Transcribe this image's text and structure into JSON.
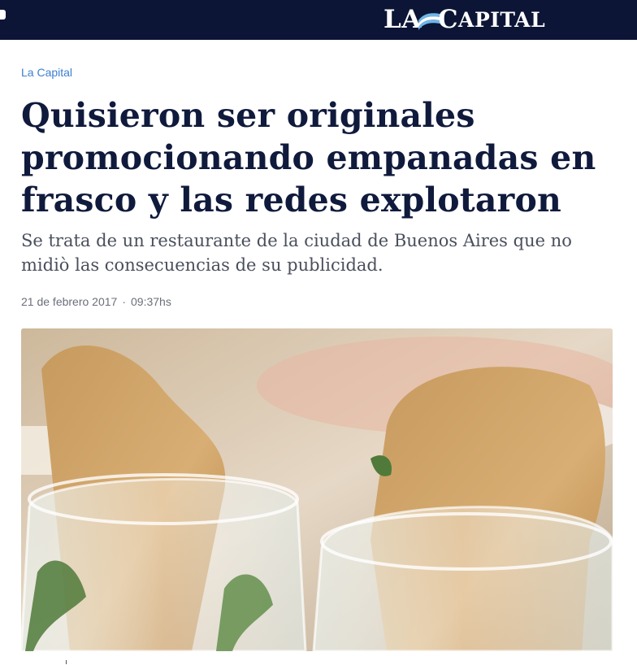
{
  "header": {
    "logo_la": "LA",
    "logo_capital": "CAPITAL",
    "brand_color": "#0c1535"
  },
  "article": {
    "section": "La Capital",
    "title": "Quisieron ser originales promocionando empanadas en frasco y las redes explotaron",
    "subtitle": "Se trata de un restaurante de la ciudad de Buenos Aires que no midiò las consecuencias de su publicidad.",
    "date": "21 de febrero 2017",
    "separator": "·",
    "time": "09:37hs",
    "image_alt": "Empanadas served in glass jars"
  },
  "colors": {
    "link": "#3b7fd1",
    "headline": "#0f1a3c",
    "subtitle": "#4a4f5c",
    "meta": "#6b6f78"
  }
}
